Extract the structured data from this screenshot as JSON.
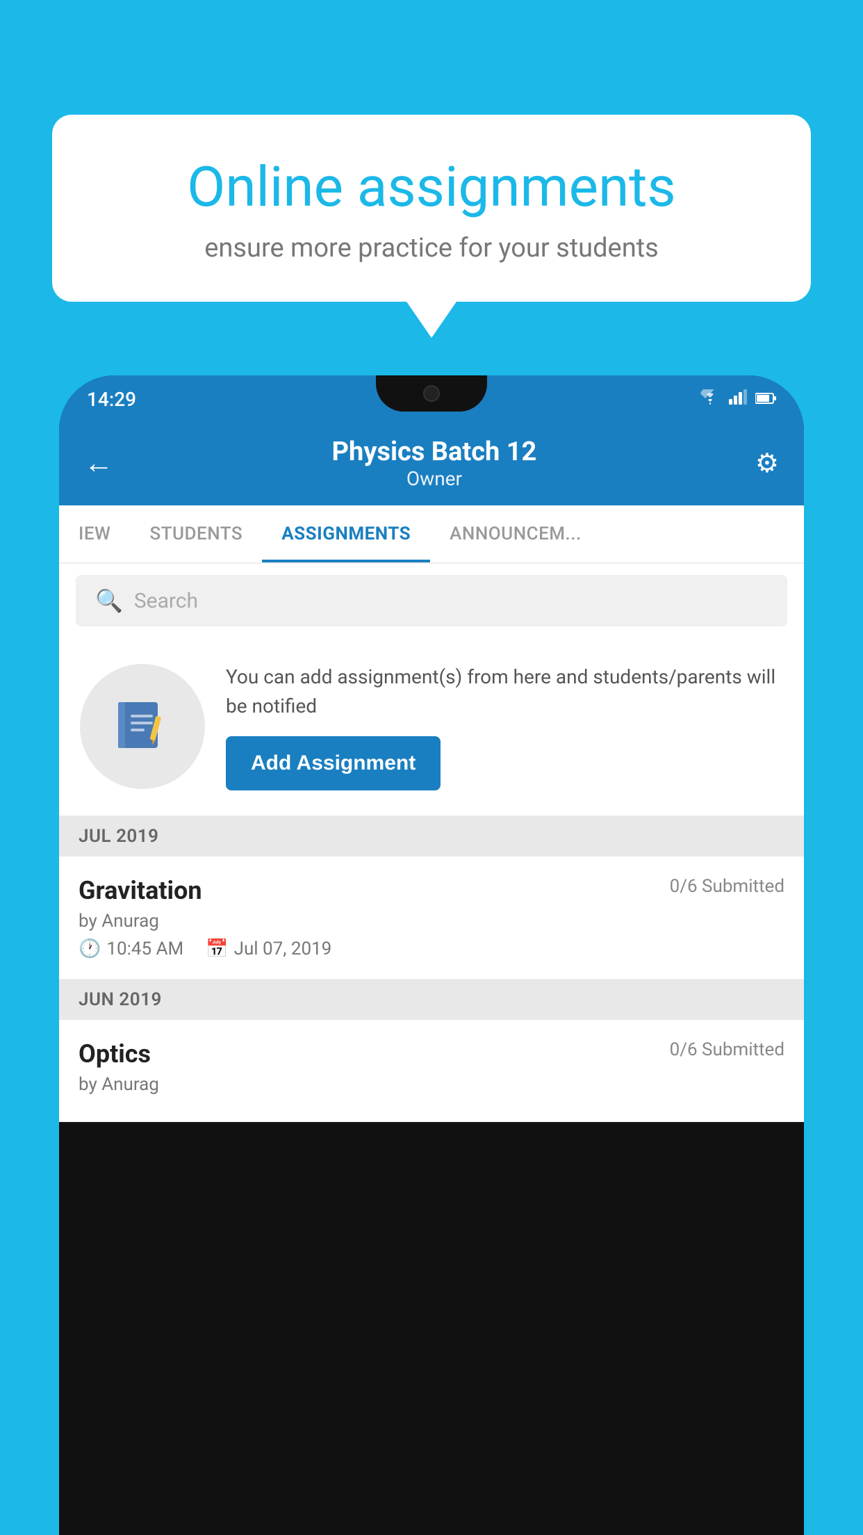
{
  "background_color": "#1BB8E8",
  "speech_bubble": {
    "title": "Online assignments",
    "subtitle": "ensure more practice for your students"
  },
  "status_bar": {
    "time": "14:29",
    "icons": [
      "wifi",
      "signal",
      "battery"
    ]
  },
  "app_header": {
    "back_label": "←",
    "title": "Physics Batch 12",
    "subtitle": "Owner",
    "settings_label": "⚙"
  },
  "tabs": [
    {
      "label": "IEW",
      "active": false
    },
    {
      "label": "STUDENTS",
      "active": false
    },
    {
      "label": "ASSIGNMENTS",
      "active": true
    },
    {
      "label": "ANNOUNCEM...",
      "active": false
    }
  ],
  "search": {
    "placeholder": "Search"
  },
  "promo": {
    "icon": "📓",
    "text": "You can add assignment(s) from here and students/parents will be notified",
    "button_label": "Add Assignment"
  },
  "sections": [
    {
      "month_label": "JUL 2019",
      "assignments": [
        {
          "name": "Gravitation",
          "submitted": "0/6 Submitted",
          "author": "by Anurag",
          "time": "10:45 AM",
          "date": "Jul 07, 2019"
        }
      ]
    },
    {
      "month_label": "JUN 2019",
      "assignments": [
        {
          "name": "Optics",
          "submitted": "0/6 Submitted",
          "author": "by Anurag",
          "time": "",
          "date": ""
        }
      ]
    }
  ]
}
